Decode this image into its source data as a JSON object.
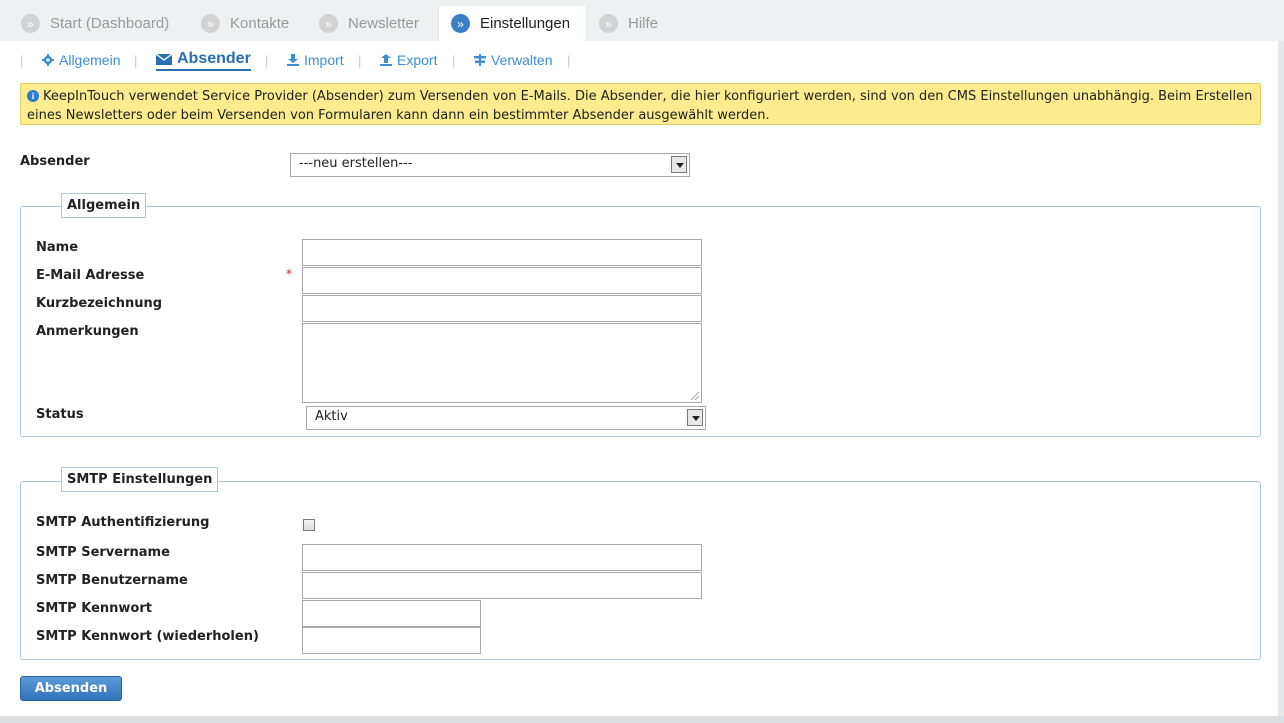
{
  "tabs": [
    {
      "label": "Start (Dashboard)",
      "active": false
    },
    {
      "label": "Kontakte",
      "active": false
    },
    {
      "label": "Newsletter",
      "active": false
    },
    {
      "label": "Einstellungen",
      "active": true
    },
    {
      "label": "Hilfe",
      "active": false
    }
  ],
  "tab_bullet": "»",
  "subnav": {
    "separator": "|",
    "items": [
      {
        "label": "Allgemein",
        "icon": "gear-icon"
      },
      {
        "label": "Absender",
        "icon": "envelope-icon",
        "active": true
      },
      {
        "label": "Import",
        "icon": "download-icon"
      },
      {
        "label": "Export",
        "icon": "upload-icon"
      },
      {
        "label": "Verwalten",
        "icon": "signpost-icon"
      }
    ]
  },
  "info": {
    "icon_glyph": "i",
    "text": "KeepInTouch verwendet Service Provider (Absender) zum Versenden von E-Mails. Die Absender, die hier konfiguriert werden, sind von den CMS Einstellungen unabhängig. Beim Erstellen eines Newsletters oder beim Versenden von Formularen kann dann ein bestimmter Absender ausgewählt werden."
  },
  "absender": {
    "label": "Absender",
    "selected": "---neu erstellen---"
  },
  "allgemein": {
    "legend": "Allgemein",
    "name_label": "Name",
    "email_label": "E-Mail Adresse",
    "required_mark": "*",
    "kurz_label": "Kurzbezeichnung",
    "anmerk_label": "Anmerkungen",
    "status_label": "Status",
    "status_value": "Aktiv"
  },
  "smtp": {
    "legend": "SMTP Einstellungen",
    "auth_label": "SMTP Authentifizierung",
    "server_label": "SMTP Servername",
    "user_label": "SMTP Benutzername",
    "pass_label": "SMTP Kennwort",
    "pass2_label": "SMTP Kennwort (wiederholen)"
  },
  "submit_label": "Absenden",
  "colors": {
    "accent": "#3a7fc6",
    "link": "#3d8dd0",
    "info_bg": "#fcec8e",
    "border": "#a9c8de"
  }
}
